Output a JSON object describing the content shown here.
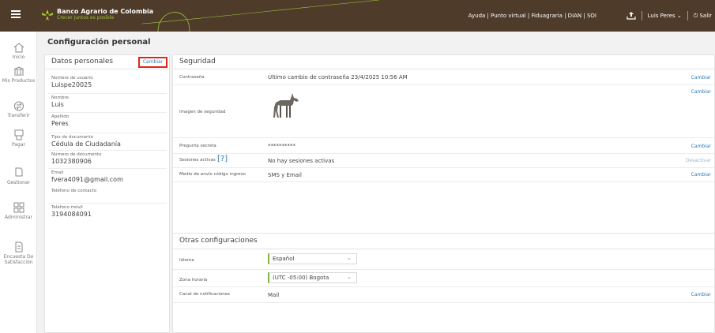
{
  "header": {
    "bank_name": "Banco Agrario de Colombia",
    "tagline": "Crecer juntos es posible",
    "links": "Ayuda | Punto virtual | Fiduagraria | DIAN | SOI",
    "user": "Luis Peres",
    "logout": "Salir"
  },
  "sidebar": {
    "items": [
      {
        "label": "Inicio",
        "icon": "home-icon"
      },
      {
        "label": "Mis Productos",
        "icon": "bank-icon"
      },
      {
        "label": "Transferir",
        "icon": "transfer-icon"
      },
      {
        "label": "Pagar",
        "icon": "pay-icon"
      },
      {
        "label": "Gestionar",
        "icon": "manage-icon"
      },
      {
        "label": "Administrar",
        "icon": "grid-icon"
      },
      {
        "label": "Encuesta De Satisfacción",
        "icon": "survey-icon"
      }
    ]
  },
  "page": {
    "title": "Configuración personal"
  },
  "personal": {
    "title": "Datos personales",
    "edit": "Cambiar",
    "fields": [
      {
        "label": "Nombre de usuario",
        "value": "Luispe20025"
      },
      {
        "label": "Nombre",
        "value": "Luis"
      },
      {
        "label": "Apellido",
        "value": "Peres"
      },
      {
        "label": "Tipo de documento",
        "value": "Cédula de Ciudadanía"
      },
      {
        "label": "Número de documento",
        "value": "1032380906"
      },
      {
        "label": "Email",
        "value": "fvera4091@gmail.com"
      },
      {
        "label": "Teléfono de contacto",
        "value": ""
      },
      {
        "label": "Teléfono móvil",
        "value": "3194084091"
      }
    ]
  },
  "security": {
    "title": "Seguridad",
    "rows": [
      {
        "label": "Contraseña",
        "value": "Último cambio de contraseña 23/4/2025 10:56 AM",
        "action": "Cambiar"
      },
      {
        "label": "Imagen de seguridad",
        "value": "",
        "action": "Cambiar"
      },
      {
        "label": "Pregunta secreta",
        "value": "**********",
        "action": "Cambiar"
      },
      {
        "label": "Sesiones activas",
        "value": "No hay sesiones activas",
        "action": "Desactivar",
        "help": "[?]"
      },
      {
        "label": "Medio de envío código ingreso",
        "value": "SMS y Email",
        "action": "Cambiar"
      }
    ]
  },
  "otras": {
    "title": "Otras configuraciones",
    "idioma_label": "Idioma",
    "idioma_value": "Español",
    "zona_label": "Zona horaria",
    "zona_value": "(UTC -05:00) Bogota",
    "canal_label": "Canal de notificaciones",
    "canal_value": "Mail",
    "canal_action": "Cambiar"
  },
  "colors": {
    "header": "#4e3b2a",
    "accent_green": "#7cb342",
    "link": "#2a7ab8",
    "highlight": "#e32219"
  }
}
